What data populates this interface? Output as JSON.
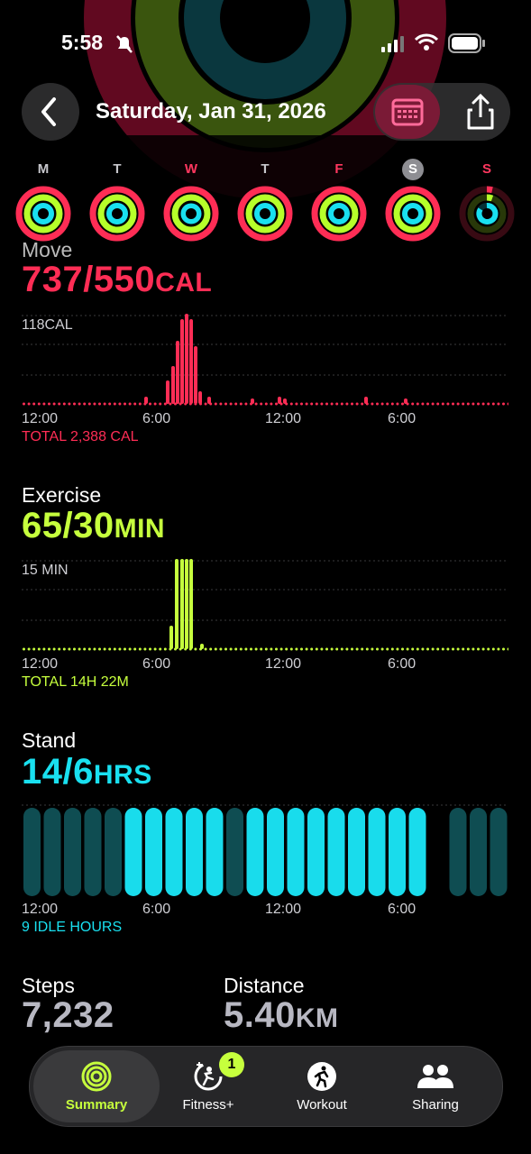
{
  "status": {
    "time": "5:58"
  },
  "header": {
    "title": "Saturday, Jan 31, 2026"
  },
  "week": [
    "M",
    "T",
    "W",
    "T",
    "F",
    "S",
    "S"
  ],
  "move": {
    "title": "Move",
    "value": "737/550",
    "unit": "CAL",
    "max_label": "118CAL",
    "ticks": [
      "12:00",
      "6:00",
      "12:00",
      "6:00"
    ],
    "total": "TOTAL 2,388 CAL",
    "color": "#ff2d55"
  },
  "exercise": {
    "title": "Exercise",
    "value": "65/30",
    "unit": "MIN",
    "max_label": "15 MIN",
    "ticks": [
      "12:00",
      "6:00",
      "12:00",
      "6:00"
    ],
    "total": "TOTAL 14H 22M",
    "color": "#c6ff3d"
  },
  "stand": {
    "title": "Stand",
    "value": "14/6",
    "unit": "HRS",
    "ticks": [
      "12:00",
      "6:00",
      "12:00",
      "6:00"
    ],
    "total": "9 IDLE HOURS",
    "color": "#19e0f0"
  },
  "steps": {
    "title": "Steps",
    "value": "7,232"
  },
  "distance": {
    "title": "Distance",
    "value": "5.40",
    "unit": "KM"
  },
  "tabs": [
    {
      "label": "Summary"
    },
    {
      "label": "Fitness+",
      "badge": "1"
    },
    {
      "label": "Workout"
    },
    {
      "label": "Sharing"
    }
  ]
}
